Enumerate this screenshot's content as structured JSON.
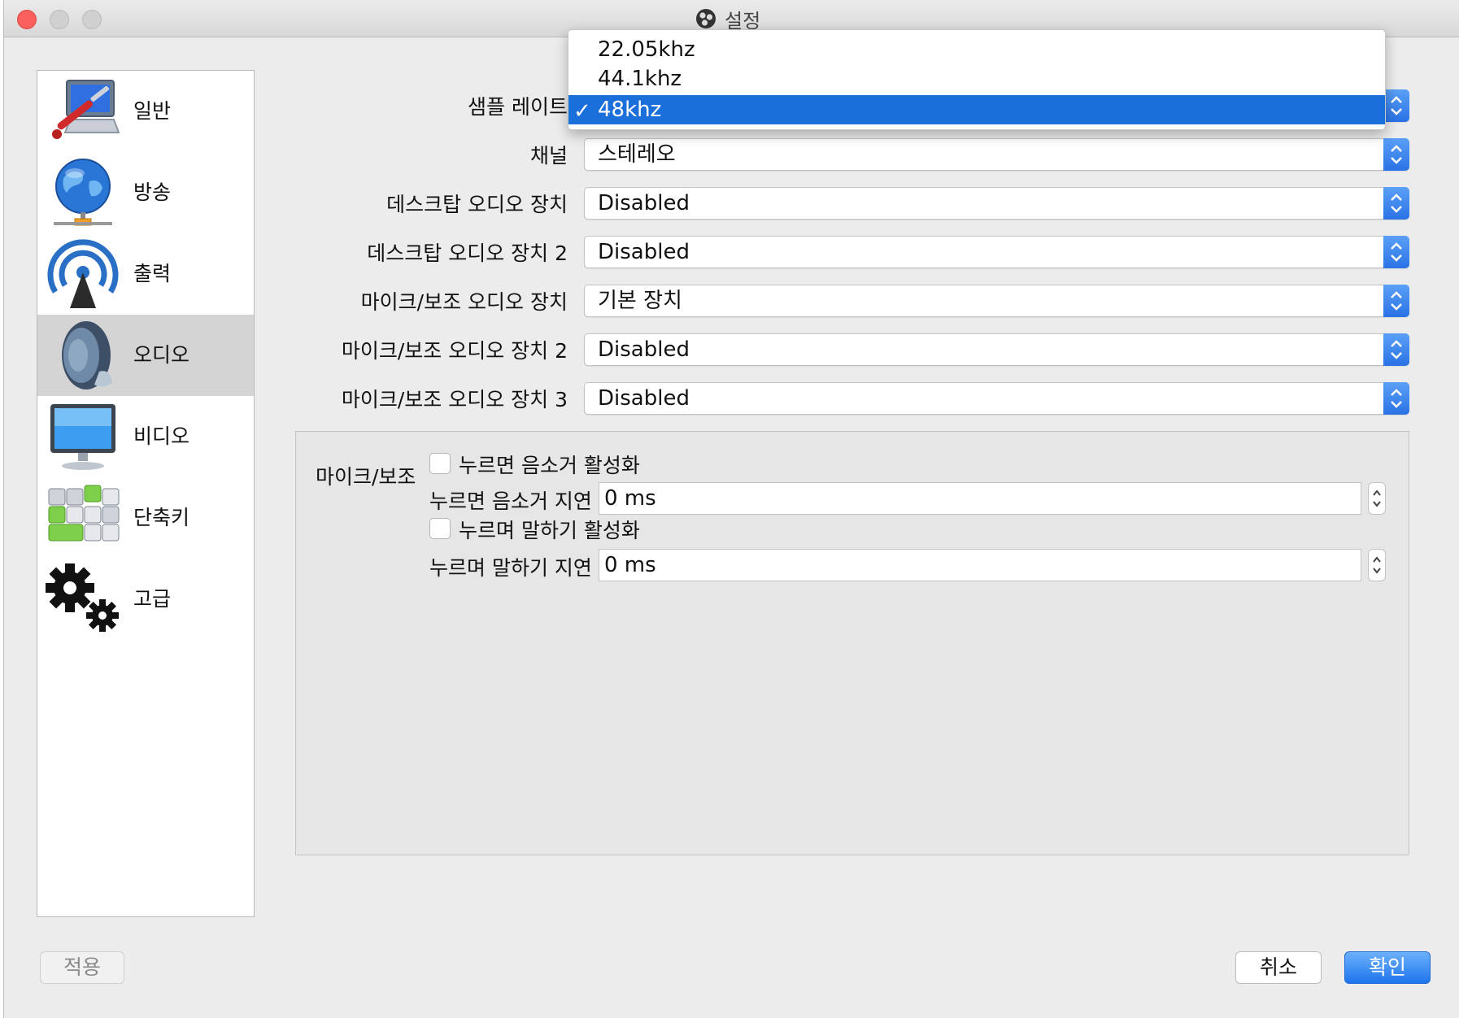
{
  "window": {
    "title": "설정"
  },
  "sidebar": {
    "items": [
      {
        "label": "일반",
        "icon": "computer-wrench-icon",
        "selected": false
      },
      {
        "label": "방송",
        "icon": "globe-network-icon",
        "selected": false
      },
      {
        "label": "출력",
        "icon": "broadcast-antenna-icon",
        "selected": false
      },
      {
        "label": "오디오",
        "icon": "speaker-icon",
        "selected": true
      },
      {
        "label": "비디오",
        "icon": "monitor-icon",
        "selected": false
      },
      {
        "label": "단축키",
        "icon": "keyboard-keys-icon",
        "selected": false
      },
      {
        "label": "고급",
        "icon": "gears-icon",
        "selected": false
      }
    ]
  },
  "audio": {
    "sample_rate": {
      "label": "샘플 레이트",
      "options": [
        "22.05khz",
        "44.1khz",
        "48khz"
      ],
      "selected": "48khz",
      "check": "✓"
    },
    "channel": {
      "label": "채널",
      "value": "스테레오"
    },
    "desktop_audio": {
      "label": "데스크탑 오디오 장치",
      "value": "Disabled"
    },
    "desktop_audio_2": {
      "label": "데스크탑 오디오 장치 2",
      "value": "Disabled"
    },
    "mic_aux": {
      "label": "마이크/보조 오디오 장치",
      "value": "기본 장치"
    },
    "mic_aux_2": {
      "label": "마이크/보조 오디오 장치 2",
      "value": "Disabled"
    },
    "mic_aux_3": {
      "label": "마이크/보조 오디오 장치 3",
      "value": "Disabled"
    }
  },
  "mic_group": {
    "title": "마이크/보조",
    "push_to_mute": {
      "label": "누르면 음소거 활성화",
      "checked": false
    },
    "push_to_mute_delay": {
      "label": "누르면 음소거 지연",
      "value": "0 ms"
    },
    "push_to_talk": {
      "label": "누르며 말하기 활성화",
      "checked": false
    },
    "push_to_talk_delay": {
      "label": "누르며 말하기 지연",
      "value": "0 ms"
    }
  },
  "buttons": {
    "apply": "적용",
    "cancel": "취소",
    "ok": "확인"
  },
  "colors": {
    "accent": "#1b6fdb",
    "selected_sidebar": "#d4d4d4",
    "close_button": "#fc605c"
  }
}
